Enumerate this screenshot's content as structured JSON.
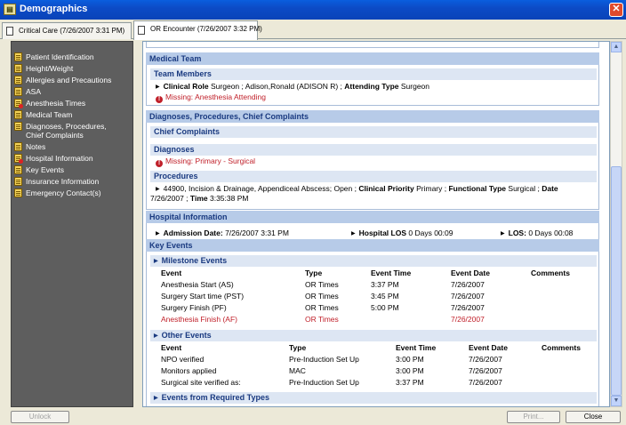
{
  "window": {
    "title": "Demographics",
    "close_glyph": "✕"
  },
  "tabs": [
    {
      "label": "Critical Care (7/26/2007 3:31 PM)"
    },
    {
      "label": "OR Encounter (7/26/2007 3:32 PM)"
    }
  ],
  "sidebar": {
    "items": [
      {
        "label": "Patient Identification",
        "icon": "document-icon"
      },
      {
        "label": "Height/Weight",
        "icon": "document-icon"
      },
      {
        "label": "Allergies and Precautions",
        "icon": "document-icon"
      },
      {
        "label": "ASA",
        "icon": "document-icon"
      },
      {
        "label": "Anesthesia Times",
        "icon": "document-warning-icon"
      },
      {
        "label": "Medical Team",
        "icon": "document-icon"
      },
      {
        "label": "Diagnoses, Procedures,",
        "label2": "Chief Complaints",
        "icon": "document-icon"
      },
      {
        "label": "Notes",
        "icon": "document-icon"
      },
      {
        "label": "Hospital Information",
        "icon": "document-warning-icon"
      },
      {
        "label": "Key Events",
        "icon": "document-icon"
      },
      {
        "label": "Insurance Information",
        "icon": "document-icon"
      },
      {
        "label": "Emergency Contact(s)",
        "icon": "document-icon"
      }
    ]
  },
  "medical_team": {
    "header": "Medical Team",
    "team_members_header": "Team Members",
    "role_label": "Clinical Role",
    "role_value": "Surgeon ; Adison,Ronald (ADISON R) ;",
    "attending_label": "Attending Type",
    "attending_value": "Surgeon",
    "missing": "Missing: Anesthesia Attending"
  },
  "diagnoses": {
    "header": "Diagnoses, Procedures, Chief Complaints",
    "chief_complaints_header": "Chief Complaints",
    "diagnoses_header": "Diagnoses",
    "missing": "Missing: Primary - Surgical",
    "procedures_header": "Procedures",
    "procedure_text": "44900, Incision & Drainage, Appendiceal Abscess; Open ;",
    "priority_label": "Clinical Priority",
    "priority_value": "Primary ;",
    "functional_label": "Functional Type",
    "functional_value": "Surgical ;",
    "date_label": "Date",
    "date_value": "7/26/2007 ;",
    "time_label": "Time",
    "time_value": "3:35:38 PM"
  },
  "hospital": {
    "header": "Hospital Information",
    "admission_label": "Admission Date:",
    "admission_value": "7/26/2007 3:31 PM",
    "hospital_los_label": "Hospital LOS",
    "hospital_los_value": "0 Days 00:09",
    "los_label": "LOS:",
    "los_value": "0 Days 00:08"
  },
  "key_events": {
    "header": "Key Events",
    "milestone_header": "Milestone Events",
    "other_header": "Other Events",
    "required_header": "Events from Required Types",
    "columns": [
      "Event",
      "Type",
      "Event Time",
      "Event Date",
      "Comments"
    ],
    "milestone_rows": [
      {
        "event": "Anesthesia Start (AS)",
        "type": "OR Times",
        "time": "3:37 PM",
        "date": "7/26/2007",
        "missing": false
      },
      {
        "event": "Surgery Start time (PST)",
        "type": "OR Times",
        "time": "3:45 PM",
        "date": "7/26/2007",
        "missing": false
      },
      {
        "event": "Surgery Finish (PF)",
        "type": "OR Times",
        "time": "5:00 PM",
        "date": "7/26/2007",
        "missing": false
      },
      {
        "event": "Anesthesia Finish (AF)",
        "type": "OR Times",
        "time": "",
        "date": "7/26/2007",
        "missing": true
      }
    ],
    "other_rows": [
      {
        "event": "NPO verified",
        "type": "Pre-Induction Set Up",
        "time": "3:00 PM",
        "date": "7/26/2007"
      },
      {
        "event": "Monitors applied",
        "type": "MAC",
        "time": "3:00 PM",
        "date": "7/26/2007"
      },
      {
        "event": "Surgical site verified as:",
        "type": "Pre-Induction Set Up",
        "time": "3:37 PM",
        "date": "7/26/2007"
      }
    ]
  },
  "buttons": {
    "unlock": "Unlock",
    "print": "Print...",
    "close": "Close"
  }
}
